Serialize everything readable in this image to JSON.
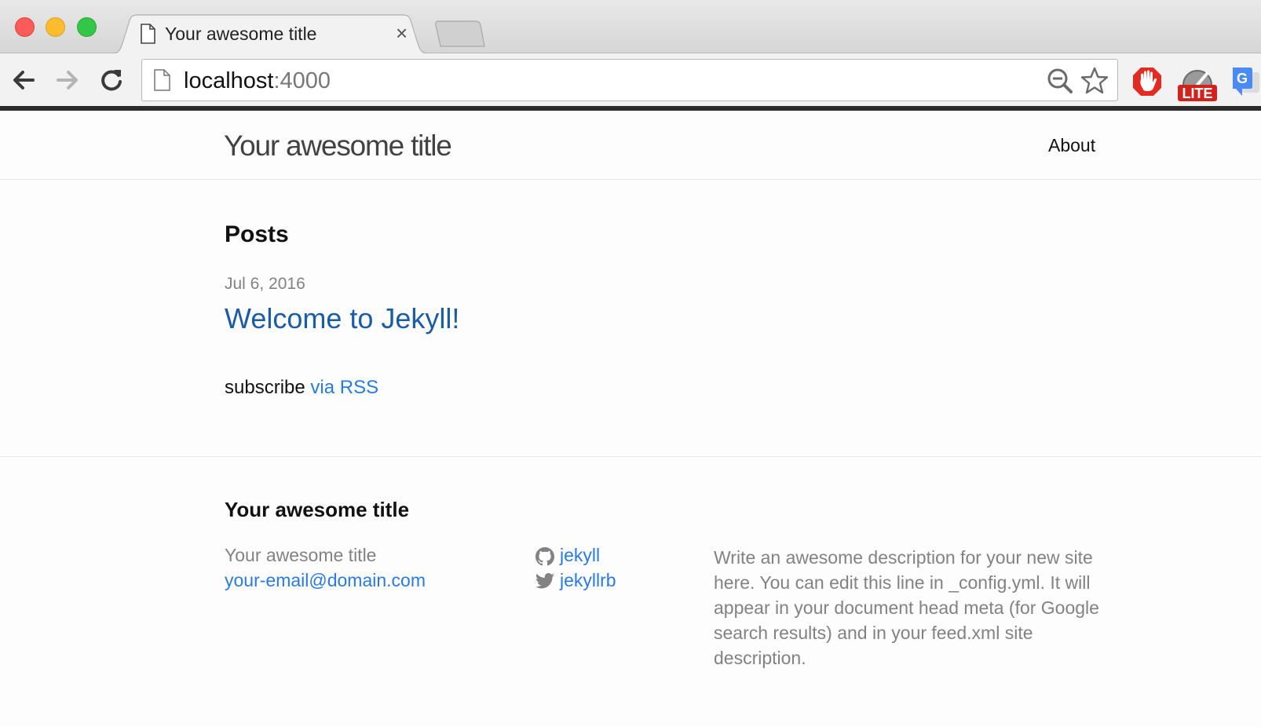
{
  "browser": {
    "tab": {
      "title": "Your awesome title",
      "close_glyph": "×"
    },
    "address": {
      "host": "localhost",
      "port": ":4000"
    },
    "extensions": [
      "adblock-icon",
      "lite-icon",
      "translate-icon"
    ],
    "lite_label": "LITE",
    "translate_label": "G"
  },
  "header": {
    "site_title": "Your awesome title",
    "nav": [
      {
        "label": "About"
      }
    ]
  },
  "main": {
    "heading": "Posts",
    "posts": [
      {
        "date": "Jul 6, 2016",
        "title": "Welcome to Jekyll!"
      }
    ],
    "rss_prefix": "subscribe",
    "rss_link": "via RSS"
  },
  "footer": {
    "heading": "Your awesome title",
    "name": "Your awesome title",
    "email": "your-email@domain.com",
    "github": "jekyll",
    "twitter": "jekyllrb",
    "description": "Write an awesome description for your new site here. You can edit this line in _config.yml. It will appear in your document head meta (for Google search results) and in your feed.xml site description."
  },
  "colors": {
    "link": "#2a7ae2",
    "post_link": "#1a5ca5",
    "muted": "#828282"
  }
}
